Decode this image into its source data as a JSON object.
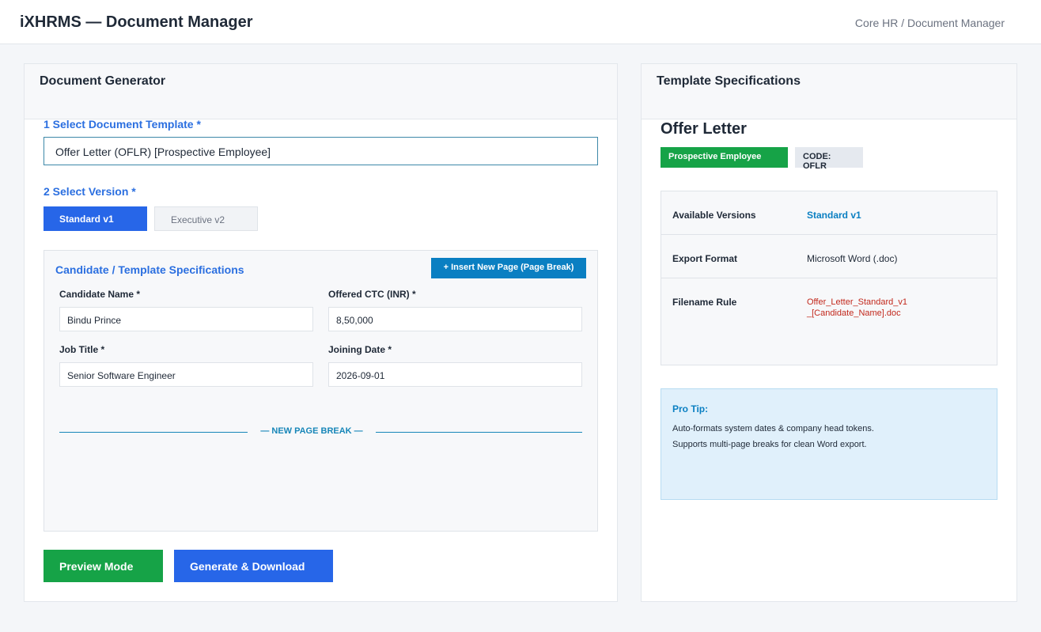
{
  "header": {
    "title": "iXHRMS — Document Manager",
    "breadcrumb": "Core HR / Document Manager"
  },
  "generator": {
    "panel_title": "Document Generator",
    "step1_label": "1  Select Document Template *",
    "template_value": "Offer Letter (OFLR) [Prospective Employee]",
    "step2_label": "2  Select Version *",
    "versions": [
      {
        "label": "Standard v1",
        "active": true
      },
      {
        "label": "Executive v2",
        "active": false
      }
    ],
    "spec_section": {
      "title": "Candidate / Template Specifications",
      "insert_button": "+ Insert New Page (Page Break)",
      "fields": [
        {
          "label": "Candidate Name *",
          "value": "Bindu Prince"
        },
        {
          "label": "Offered CTC (INR) *",
          "value": "8,50,000"
        },
        {
          "label": "Job Title *",
          "value": "Senior Software Engineer"
        },
        {
          "label": "Joining Date *",
          "value": "2026-09-01"
        }
      ],
      "page_break_label": "— NEW PAGE BREAK —"
    },
    "preview_button": "Preview Mode",
    "generate_button": "Generate & Download"
  },
  "specs": {
    "panel_title": "Template Specifications",
    "document_name": "Offer Letter",
    "category_badge": "Prospective Employee",
    "code_badge": "CODE: OFLR",
    "rows": [
      {
        "key": "Available Versions",
        "value": "Standard v1"
      },
      {
        "key": "Export Format",
        "value": "Microsoft Word (.doc)"
      },
      {
        "key": "Filename Rule",
        "value_line1": "Offer_Letter_Standard_v1",
        "value_line2": "_[Candidate_Name].doc"
      }
    ],
    "tip": {
      "title": "Pro Tip:",
      "lines": [
        "Auto-formats system dates & company head tokens.",
        "Supports multi-page breaks for clean Word export."
      ]
    }
  },
  "colors": {
    "primary_blue": "#2766e8",
    "accent_teal": "#0a7fc2",
    "success_green": "#16a347",
    "filename_red": "#c2281c",
    "tip_background": "#e0f0fb"
  }
}
